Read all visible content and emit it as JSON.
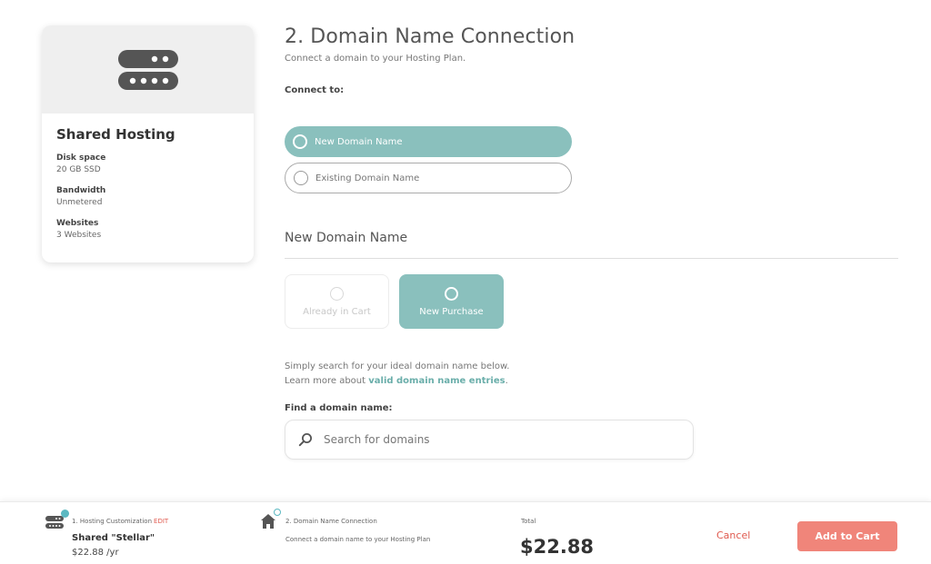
{
  "plan_card": {
    "title": "Shared Hosting",
    "specs": [
      {
        "label": "Disk space",
        "value": "20 GB SSD"
      },
      {
        "label": "Bandwidth",
        "value": "Unmetered"
      },
      {
        "label": "Websites",
        "value": "3 Websites"
      }
    ],
    "icon": "server-icon"
  },
  "step": {
    "title": "2. Domain Name Connection",
    "subtitle": "Connect a domain to your Hosting Plan.",
    "connect_label": "Connect to:",
    "options": [
      {
        "label": "New Domain Name",
        "selected": true
      },
      {
        "label": "Existing Domain Name",
        "selected": false
      }
    ],
    "section_title": "New Domain Name",
    "tiles": [
      {
        "label": "Already in Cart",
        "enabled": false
      },
      {
        "label": "New Purchase",
        "enabled": true,
        "selected": true
      }
    ],
    "helper_line1": "Simply search for your ideal domain name below.",
    "helper_line2_prefix": "Learn more about ",
    "helper_link": "valid domain name entries",
    "helper_line2_suffix": ".",
    "find_label": "Find a domain name:",
    "search_placeholder": "Search for domains"
  },
  "footer": {
    "step1_label": "1. Hosting Customization",
    "step1_edit": "EDIT",
    "plan_name": "Shared \"Stellar\"",
    "plan_price": "$22.88 /yr",
    "step2_label": "2. Domain Name Connection",
    "step2_desc": "Connect a domain name to your Hosting Plan",
    "total_label": "Total",
    "total_value": "$22.88",
    "cancel_label": "Cancel",
    "add_label": "Add to Cart"
  },
  "colors": {
    "accent_teal": "#8ac0bd",
    "link_teal": "#6aaeaa",
    "cta_coral": "#f0857a",
    "cancel_red": "#e05a4f"
  }
}
